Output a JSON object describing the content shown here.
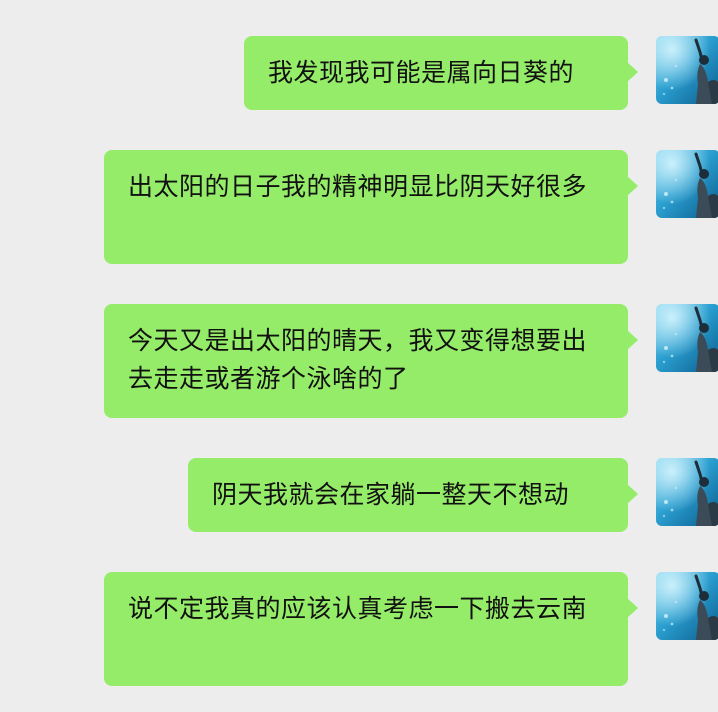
{
  "chat": {
    "messages": [
      {
        "text": "我发现我可能是属向日葵的",
        "sender": "self",
        "avatar_icon": "user-avatar-underwater-icon"
      },
      {
        "text": "出太阳的日子我的精神明显比阴天好很多",
        "sender": "self",
        "avatar_icon": "user-avatar-underwater-icon"
      },
      {
        "text": "今天又是出太阳的晴天，我又变得想要出去走走或者游个泳啥的了",
        "sender": "self",
        "avatar_icon": "user-avatar-underwater-icon"
      },
      {
        "text": "阴天我就会在家躺一整天不想动",
        "sender": "self",
        "avatar_icon": "user-avatar-underwater-icon"
      },
      {
        "text": "说不定我真的应该认真考虑一下搬去云南",
        "sender": "self",
        "avatar_icon": "user-avatar-underwater-icon"
      }
    ]
  },
  "colors": {
    "background": "#ededed",
    "bubble_self": "#95ec69",
    "text": "#111111"
  }
}
